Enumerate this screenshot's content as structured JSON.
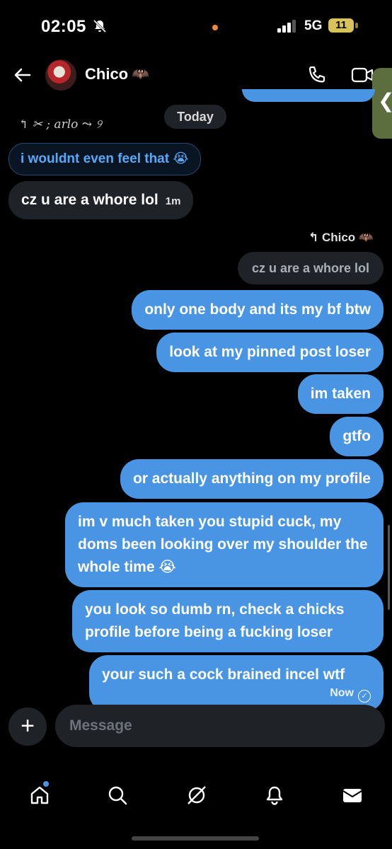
{
  "status_bar": {
    "time": "02:05",
    "network": "5G",
    "battery": "11"
  },
  "header": {
    "contact_name": "Chico",
    "contact_emoji": "🦇"
  },
  "chat": {
    "date_divider": "Today",
    "incoming_reply_label": "↰ ✂ ; arlo ⤳ ୨",
    "incoming_quoted": "i wouldnt even feel that 😭",
    "incoming_message": {
      "text": "cz u are a whore lol",
      "time": "1m"
    },
    "outgoing_reply_label": "↰ Chico 🦇",
    "outgoing_quoted": "cz u are a whore lol",
    "outgoing_messages": [
      "only one body and its my bf btw",
      "look at my pinned post loser",
      "im taken",
      "gtfo",
      "or actually anything on my profile",
      "im v much taken you stupid cuck, my doms been looking over my shoulder the whole time 😭",
      "you look so dumb rn, check a chicks profile before being a fucking loser",
      "your such a cock brained incel wtf"
    ],
    "last_status": "Now"
  },
  "composer": {
    "placeholder": "Message"
  },
  "colors": {
    "bubble_blue": "#4a95e3",
    "surface": "#1f2226",
    "background": "#000000"
  },
  "nav": {
    "items": [
      "home-icon",
      "search-icon",
      "grok-icon",
      "notifications-icon",
      "messages-icon"
    ]
  }
}
